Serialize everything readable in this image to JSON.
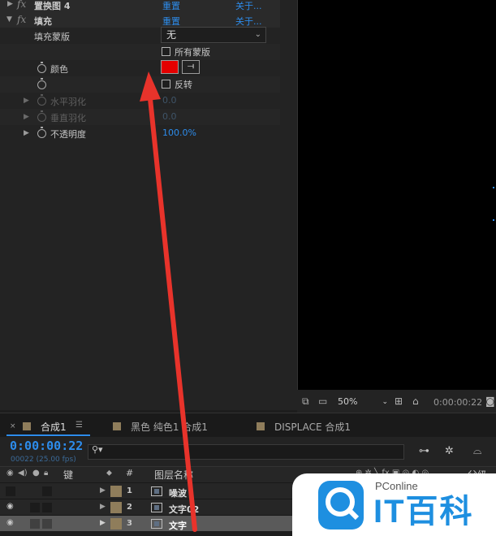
{
  "effect_controls": {
    "fx_prev": {
      "name": "置换图 4",
      "reset": "重置",
      "about": "关于..."
    },
    "fx_fill": {
      "name": "填充",
      "reset": "重置",
      "about": "关于..."
    },
    "fill_mask_label": "填充蒙版",
    "fill_mask_value": "无",
    "all_masks_label": "所有蒙版",
    "color_label": "颜色",
    "fill_color": "#e40000",
    "invert_label": "反转",
    "h_feather_label": "水平羽化",
    "h_feather_value": "0.0",
    "v_feather_label": "垂直羽化",
    "v_feather_value": "0.0",
    "opacity_label": "不透明度",
    "opacity_value": "100.0%"
  },
  "viewer": {
    "zoom": "50%",
    "timecode": "0:00:00:22"
  },
  "timeline": {
    "tabs": [
      {
        "label": "合成1",
        "active": true
      },
      {
        "label": "黑色 纯色1 合成1",
        "active": false
      },
      {
        "label": "DISPLACE 合成1",
        "active": false
      }
    ],
    "timecode": "0:00:00:22",
    "framecode": "00022 (25.00 fps)",
    "columns": {
      "keys": "键",
      "number": "#",
      "layer_name": "图层名称",
      "parent": "父级"
    },
    "layers": [
      {
        "num": "1",
        "name": "噪波"
      },
      {
        "num": "2",
        "name": "文字02"
      },
      {
        "num": "3",
        "name": "文字"
      }
    ]
  },
  "watermark": {
    "brand": "PConline",
    "title": "IT百科"
  }
}
